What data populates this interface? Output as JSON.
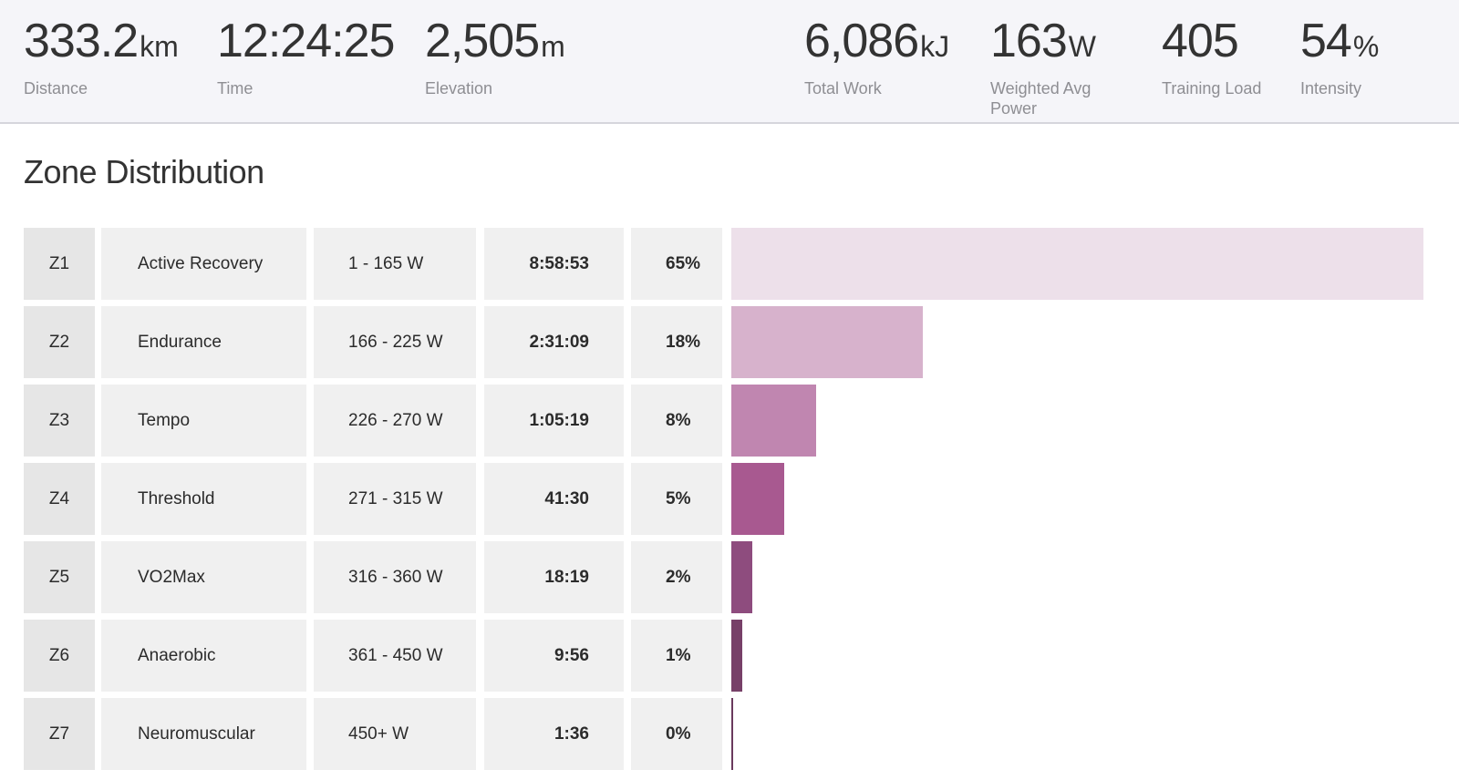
{
  "stats_left": [
    {
      "value": "333.2",
      "unit": "km",
      "label": "Distance"
    },
    {
      "value": "12:24:25",
      "unit": "",
      "label": "Time"
    },
    {
      "value": "2,505",
      "unit": "m",
      "label": "Elevation"
    }
  ],
  "stats_right": [
    {
      "value": "6,086",
      "unit": "kJ",
      "label": "Total Work"
    },
    {
      "value": "163",
      "unit": "W",
      "label": "Weighted Avg Power"
    },
    {
      "value": "405",
      "unit": "",
      "label": "Training Load"
    },
    {
      "value": "54",
      "unit": "%",
      "label": "Intensity"
    }
  ],
  "zone_section": {
    "title": "Zone Distribution"
  },
  "zones": [
    {
      "zone": "Z1",
      "name": "Active Recovery",
      "range": "1 - 165 W",
      "time": "8:58:53",
      "pct": "65%",
      "fraction": 0.65,
      "color": "#ede0ea"
    },
    {
      "zone": "Z2",
      "name": "Endurance",
      "range": "166 - 225 W",
      "time": "2:31:09",
      "pct": "18%",
      "fraction": 0.18,
      "color": "#d7b2cc"
    },
    {
      "zone": "Z3",
      "name": "Tempo",
      "range": "226 - 270 W",
      "time": "1:05:19",
      "pct": "8%",
      "fraction": 0.08,
      "color": "#c086b0"
    },
    {
      "zone": "Z4",
      "name": "Threshold",
      "range": "271 - 315 W",
      "time": "41:30",
      "pct": "5%",
      "fraction": 0.05,
      "color": "#a85990"
    },
    {
      "zone": "Z5",
      "name": "VO2Max",
      "range": "316 - 360 W",
      "time": "18:19",
      "pct": "2%",
      "fraction": 0.02,
      "color": "#8e4c7e"
    },
    {
      "zone": "Z6",
      "name": "Anaerobic",
      "range": "361 - 450 W",
      "time": "9:56",
      "pct": "1%",
      "fraction": 0.01,
      "color": "#774068"
    },
    {
      "zone": "Z7",
      "name": "Neuromuscular",
      "range": "450+ W",
      "time": "1:36",
      "pct": "0%",
      "fraction": 0.002,
      "color": "#6a3a5d"
    }
  ]
}
